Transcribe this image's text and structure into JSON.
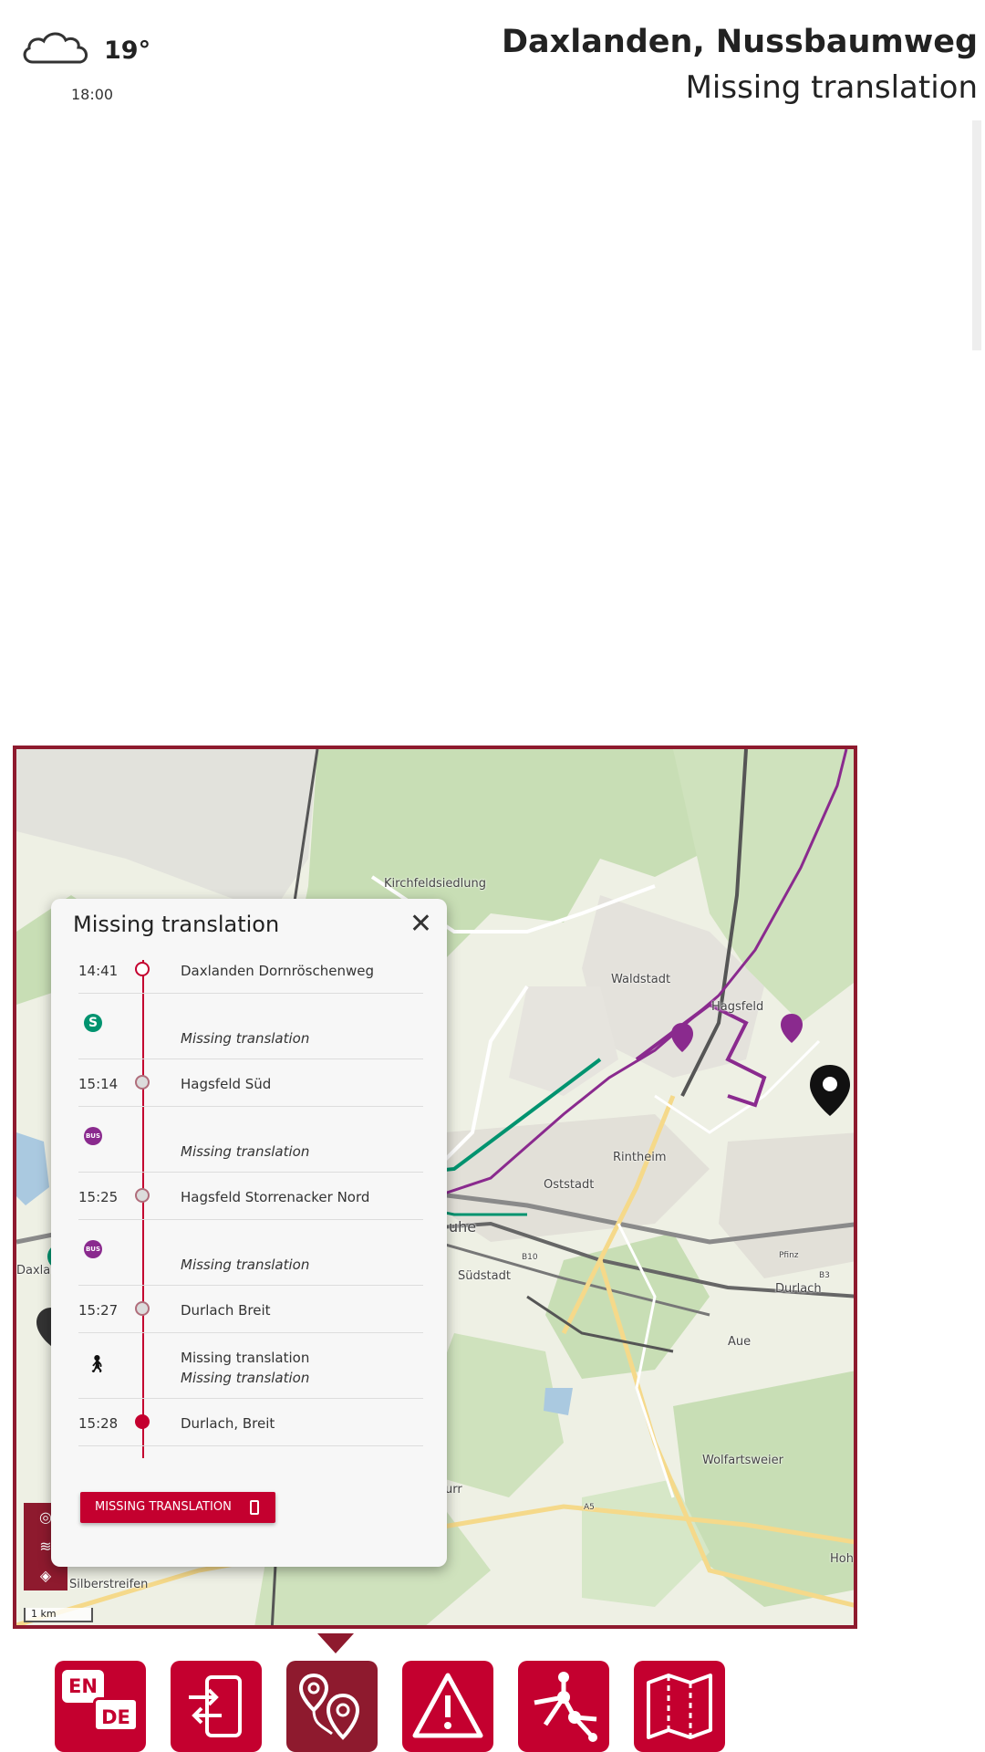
{
  "weather": {
    "icon": "cloud-icon",
    "temperature": "19°",
    "time": "18:00"
  },
  "stop": {
    "name": "Daxlanden, Nussbaumweg",
    "subtitle": "Missing translation"
  },
  "map": {
    "labels": [
      "Kirchfeldsiedlung",
      "Waldstadt",
      "Hagsfeld",
      "Rintheim",
      "Oststadt",
      "uhe",
      "Südstadt",
      "Durlach",
      "Aue",
      "Wolfartsweier",
      "Silberstreifen",
      "urr",
      "Hoh",
      "Daxlan",
      "A5",
      "B10",
      "B3",
      "Pfinz"
    ],
    "scale": "1 km",
    "route_colors": {
      "sbahn": "#00936f",
      "bus": "#8a2a8e"
    }
  },
  "panel": {
    "title": "Missing translation",
    "rows": [
      {
        "time": "14:41",
        "text": "Daxlanden Dornröschenweg"
      },
      {
        "icon": "s-bahn-icon",
        "text": "Missing translation"
      },
      {
        "time": "15:14",
        "text": "Hagsfeld Süd"
      },
      {
        "icon": "bus-icon",
        "text": "Missing translation"
      },
      {
        "time": "15:25",
        "text": "Hagsfeld Storrenacker Nord"
      },
      {
        "icon": "bus-icon",
        "text": "Missing translation"
      },
      {
        "time": "15:27",
        "text": "Durlach Breit"
      },
      {
        "icon": "walk-icon",
        "text": "Missing translation",
        "text2": "Missing translation"
      },
      {
        "time": "15:28",
        "text": "Durlach, Breit"
      }
    ],
    "bus_icon_text": "BUS",
    "s_icon_text": "S",
    "button_label": "MISSING TRANSLATION"
  },
  "nav": {
    "items": [
      {
        "icon": "language-icon",
        "en": "EN",
        "de": "DE"
      },
      {
        "icon": "phone-transfer-icon"
      },
      {
        "icon": "route-map-icon",
        "active": true
      },
      {
        "icon": "warning-icon"
      },
      {
        "icon": "network-icon"
      },
      {
        "icon": "map-icon"
      }
    ]
  }
}
